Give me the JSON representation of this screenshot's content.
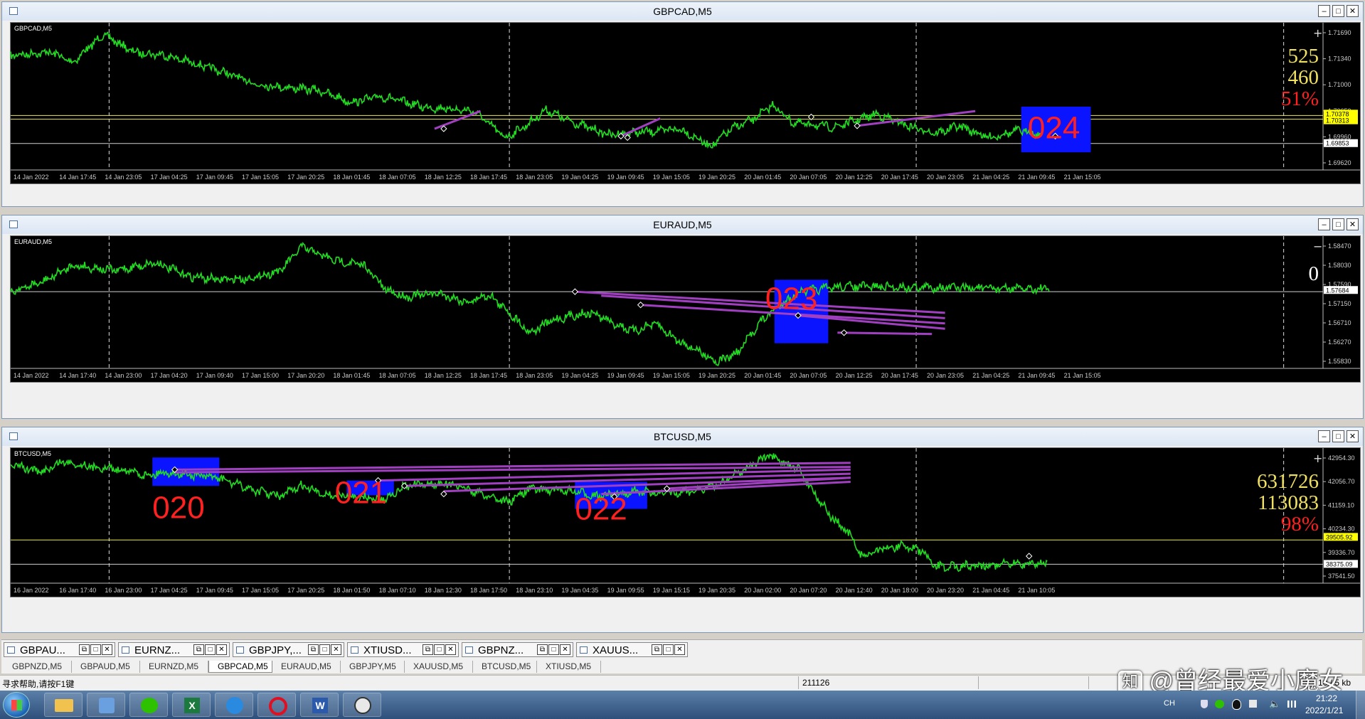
{
  "windows": [
    {
      "title": "GBPCAD,M5",
      "symbol": "GBPCAD,M5",
      "price_labels": [
        "1.71690",
        "1.71340",
        "1.71000",
        "1.70650",
        "1.69960",
        "1.69620"
      ],
      "price_tags": [
        {
          "text": "1.70378",
          "color": "#ffff00"
        },
        {
          "text": "1.70313",
          "color": "#ffff00"
        },
        {
          "text": "1.69853",
          "color": "#ffffff"
        }
      ],
      "time_labels": [
        "14 Jan 2022",
        "14 Jan 17:45",
        "14 Jan 23:05",
        "17 Jan 04:25",
        "17 Jan 09:45",
        "17 Jan 15:05",
        "17 Jan 20:25",
        "18 Jan 01:45",
        "18 Jan 07:05",
        "18 Jan 12:25",
        "18 Jan 17:45",
        "18 Jan 23:05",
        "19 Jan 04:25",
        "19 Jan 09:45",
        "19 Jan 15:05",
        "19 Jan 20:25",
        "20 Jan 01:45",
        "20 Jan 07:05",
        "20 Jan 12:25",
        "20 Jan 17:45",
        "20 Jan 23:05",
        "21 Jan 04:25",
        "21 Jan 09:45",
        "21 Jan 15:05"
      ],
      "stats": [
        "525",
        "460",
        "51%"
      ],
      "corner_sign": "+",
      "box_labels": [
        "024"
      ]
    },
    {
      "title": "EURAUD,M5",
      "symbol": "EURAUD,M5",
      "price_labels": [
        "1.58470",
        "1.58030",
        "1.57590",
        "1.57150",
        "1.56710",
        "1.56270",
        "1.55830"
      ],
      "price_tags": [
        {
          "text": "1.57684",
          "color": "#ffffff"
        }
      ],
      "time_labels": [
        "14 Jan 2022",
        "14 Jan 17:40",
        "14 Jan 23:00",
        "17 Jan 04:20",
        "17 Jan 09:40",
        "17 Jan 15:00",
        "17 Jan 20:20",
        "18 Jan 01:45",
        "18 Jan 07:05",
        "18 Jan 12:25",
        "18 Jan 17:45",
        "18 Jan 23:05",
        "19 Jan 04:25",
        "19 Jan 09:45",
        "19 Jan 15:05",
        "19 Jan 20:25",
        "20 Jan 01:45",
        "20 Jan 07:05",
        "20 Jan 12:25",
        "20 Jan 17:45",
        "20 Jan 23:05",
        "21 Jan 04:25",
        "21 Jan 09:45",
        "21 Jan 15:05"
      ],
      "stats": [
        "0"
      ],
      "corner_sign": "−",
      "box_labels": [
        "023"
      ]
    },
    {
      "title": "BTCUSD,M5",
      "symbol": "BTCUSD,M5",
      "price_labels": [
        "42954.30",
        "42056.70",
        "41159.10",
        "40234.30",
        "39336.70",
        "37541.50"
      ],
      "price_tags": [
        {
          "text": "39505.92",
          "color": "#ffff00"
        },
        {
          "text": "38375.09",
          "color": "#ffffff"
        }
      ],
      "time_labels": [
        "16 Jan 2022",
        "16 Jan 17:40",
        "16 Jan 23:00",
        "17 Jan 04:25",
        "17 Jan 09:45",
        "17 Jan 15:05",
        "17 Jan 20:25",
        "18 Jan 01:50",
        "18 Jan 07:10",
        "18 Jan 12:30",
        "18 Jan 17:50",
        "18 Jan 23:10",
        "19 Jan 04:35",
        "19 Jan 09:55",
        "19 Jan 15:15",
        "19 Jan 20:35",
        "20 Jan 02:00",
        "20 Jan 07:20",
        "20 Jan 12:40",
        "20 Jan 18:00",
        "20 Jan 23:20",
        "21 Jan 04:45",
        "21 Jan 10:05"
      ],
      "stats": [
        "631726",
        "113083",
        "98%"
      ],
      "corner_sign": "+",
      "box_labels": [
        "020",
        "021",
        "022"
      ]
    }
  ],
  "mdi_tabs": [
    "GBPAU...",
    "EURNZ...",
    "GBPJPY,...",
    "XTIUSD...",
    "GBPNZ...",
    "XAUUS..."
  ],
  "chart_tabs": [
    "GBPNZD,M5",
    "GBPAUD,M5",
    "EURNZD,M5",
    "GBPCAD,M5",
    "EURAUD,M5",
    "GBPJPY,M5",
    "XAUUSD,M5",
    "BTCUSD,M5",
    "XTIUSD,M5"
  ],
  "active_chart_tab": "GBPCAD,M5",
  "status": {
    "help": "寻求帮助,请按F1键",
    "value": "211126",
    "right": "10 / 5 kb"
  },
  "watermark": "@曾经最爱小魔女",
  "taskbar": {
    "time": "21:22",
    "date": "2022/1/21",
    "ime": "CH",
    "icons": [
      "start-icon",
      "folder-icon",
      "network-icon",
      "wechat-icon",
      "excel-icon",
      "browser-icon",
      "opera-icon",
      "word-icon",
      "metatrader-icon"
    ]
  },
  "colors": {
    "price_line": "#22dd22",
    "box": "#0a14ff",
    "trend_line": "#a040c0",
    "big_label": "#ff2020"
  }
}
